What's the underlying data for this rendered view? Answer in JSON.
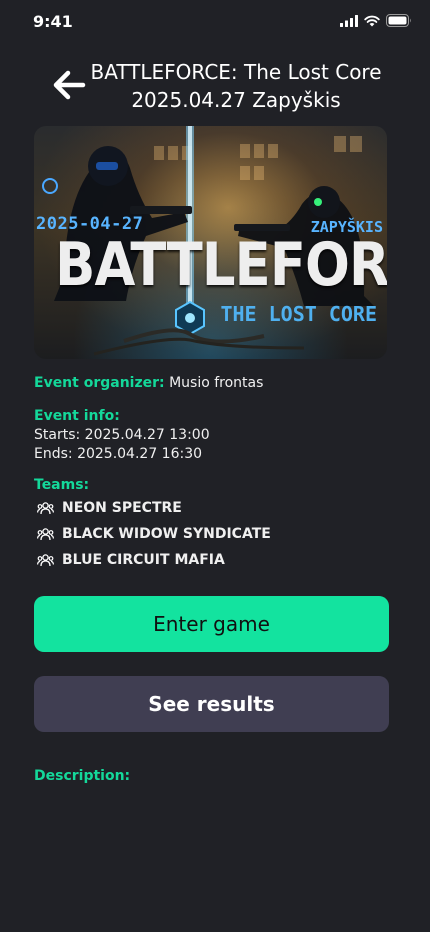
{
  "status_bar": {
    "time": "9:41"
  },
  "header": {
    "title_line1": "BATTLEFORCE: The Lost Core",
    "title_line2": "2025.04.27 Zapyškis"
  },
  "hero": {
    "date_text": "2025-04-27",
    "place_text": "ZAPYŠKIS",
    "title_text": "BATTLEFORCE:",
    "subtitle_text": "THE LOST CORE"
  },
  "organizer": {
    "label": "Event organizer:",
    "value": "Musio frontas"
  },
  "event_info": {
    "label": "Event info:",
    "starts": "Starts: 2025.04.27 13:00",
    "ends": "Ends: 2025.04.27 16:30"
  },
  "teams": {
    "label": "Teams:",
    "items": [
      "NEON SPECTRE",
      "BLACK WIDOW SYNDICATE",
      "BLUE CIRCUIT MAFIA"
    ]
  },
  "buttons": {
    "enter": "Enter game",
    "results": "See results"
  },
  "description": {
    "label": "Description:"
  },
  "colors": {
    "background": "#202126",
    "accent": "#13e39f",
    "secondary_button": "#403e52"
  },
  "icons": {
    "back": "arrow-left-icon",
    "team": "team-icon"
  }
}
